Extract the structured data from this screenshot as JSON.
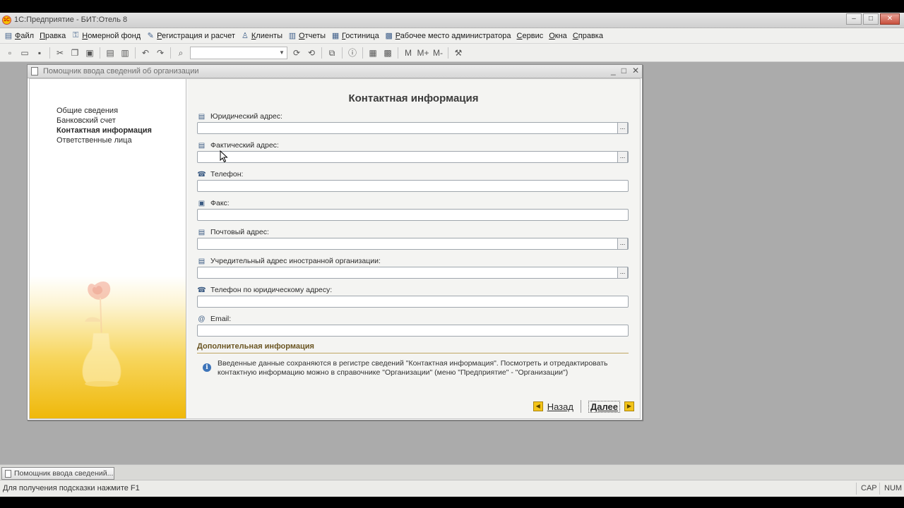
{
  "app": {
    "title": "1С:Предприятие - БИТ:Отель 8",
    "logo_text": "1С",
    "window_controls": [
      "–",
      "□",
      "✕"
    ]
  },
  "menubar": [
    {
      "label": "Файл",
      "icon": "file-menu-icon",
      "glyph": "▤"
    },
    {
      "label": "Правка",
      "icon": "",
      "glyph": ""
    },
    {
      "label": "Номерной фонд",
      "icon": "rooms-icon",
      "glyph": "⚿"
    },
    {
      "label": "Регистрация и расчет",
      "icon": "registration-icon",
      "glyph": "✎"
    },
    {
      "label": "Клиенты",
      "icon": "clients-icon",
      "glyph": "♙"
    },
    {
      "label": "Отчеты",
      "icon": "reports-icon",
      "glyph": "▥"
    },
    {
      "label": "Гостиница",
      "icon": "hotel-icon",
      "glyph": "▦"
    },
    {
      "label": "Рабочее место администратора",
      "icon": "admin-workplace-icon",
      "glyph": "▩"
    },
    {
      "label": "Сервис",
      "icon": "",
      "glyph": ""
    },
    {
      "label": "Окна",
      "icon": "",
      "glyph": ""
    },
    {
      "label": "Справка",
      "icon": "",
      "glyph": ""
    }
  ],
  "toolbar": {
    "search_value": ""
  },
  "dialog": {
    "title": "Помощник ввода сведений об организации",
    "heading": "Контактная информация",
    "steps": [
      {
        "label": "Общие сведения",
        "active": false
      },
      {
        "label": "Банковский счет",
        "active": false
      },
      {
        "label": "Контактная информация",
        "active": true
      },
      {
        "label": "Ответственные лица",
        "active": false
      }
    ],
    "fields": [
      {
        "label": "Юридический адрес:",
        "icon": "address-icon",
        "glyph": "▤",
        "value": "",
        "has_select_button": true
      },
      {
        "label": "Фактический адрес:",
        "icon": "address-icon",
        "glyph": "▤",
        "value": "",
        "has_select_button": true
      },
      {
        "label": "Телефон:",
        "icon": "phone-icon",
        "glyph": "☎",
        "value": "",
        "has_select_button": false
      },
      {
        "label": "Факс:",
        "icon": "fax-icon",
        "glyph": "▣",
        "value": "",
        "has_select_button": false
      },
      {
        "label": "Почтовый адрес:",
        "icon": "address-icon",
        "glyph": "▤",
        "value": "",
        "has_select_button": true
      },
      {
        "label": "Учредительный адрес иностранной организации:",
        "icon": "address-icon",
        "glyph": "▤",
        "value": "",
        "has_select_button": true
      },
      {
        "label": "Телефон по юридическому адресу:",
        "icon": "phone-icon",
        "glyph": "☎",
        "value": "",
        "has_select_button": false
      },
      {
        "label": "Email:",
        "icon": "email-icon",
        "glyph": "@",
        "value": "",
        "has_select_button": false
      }
    ],
    "select_button_label": "...",
    "additional_info_title": "Дополнительная информация",
    "info_text": "Введенные данные сохраняются в регистре сведений \"Контактная информация\". Посмотреть и отредактировать контактную информацию можно в справочнике \"Организации\" (меню \"Предприятие\" - \"Организации\")",
    "back_label": "Назад",
    "next_label": "Далее"
  },
  "taskbar": {
    "window_button_label": "Помощник ввода сведений..."
  },
  "statusbar": {
    "hint": "Для получения подсказки нажмите F1",
    "caps": "CAP",
    "num": "NUM"
  },
  "colors": {
    "accent_yellow": "#efb80a",
    "section_title": "#6b5623",
    "close_button": "#c8503d"
  }
}
